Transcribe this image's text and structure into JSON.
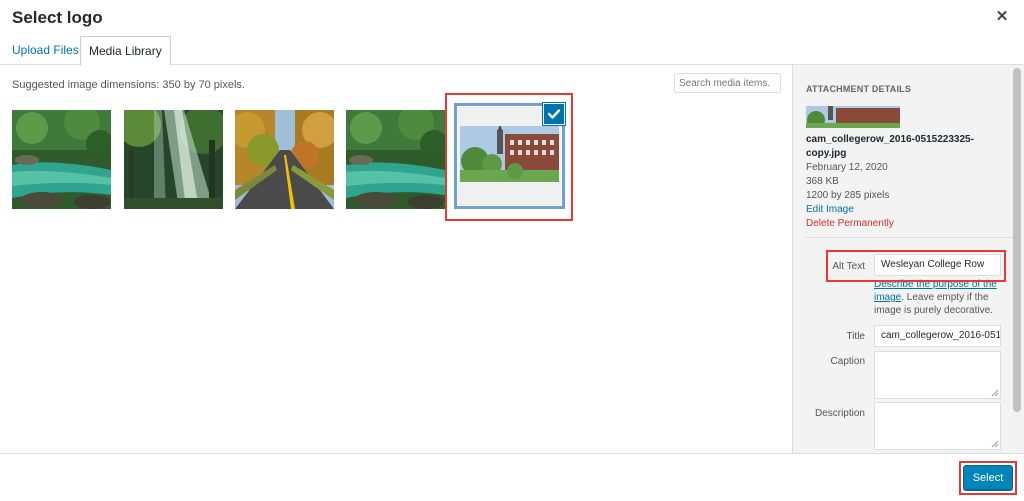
{
  "modal": {
    "title": "Select logo",
    "close_glyph": "✕"
  },
  "tabs": [
    {
      "label": "Upload Files",
      "active": false
    },
    {
      "label": "Media Library",
      "active": true
    }
  ],
  "content": {
    "suggested": "Suggested image dimensions: 350 by 70 pixels.",
    "search_placeholder": "Search media items."
  },
  "sidebar": {
    "heading": "ATTACHMENT DETAILS",
    "filename": "cam_collegerow_2016-0515223325-copy.jpg",
    "date": "February 12, 2020",
    "size": "368 KB",
    "dimensions": "1200 by 285 pixels",
    "edit_link": "Edit Image",
    "delete_link": "Delete Permanently",
    "alt_label": "Alt Text",
    "alt_value": "Wesleyan College Row",
    "describe_link": "Describe the purpose of the image",
    "describe_rest": ". Leave empty if the image is purely decorative.",
    "title_label": "Title",
    "title_value": "cam_collegerow_2016-051",
    "caption_label": "Caption",
    "description_label": "Description"
  },
  "footer": {
    "select_label": "Select"
  },
  "colors": {
    "accent": "#0085ba",
    "link": "#0073aa",
    "danger": "#d32f2f",
    "highlight": "#e53935"
  },
  "icons": {
    "close": "close-icon",
    "check": "checkmark-icon",
    "resize": "resize-handle-icon"
  }
}
